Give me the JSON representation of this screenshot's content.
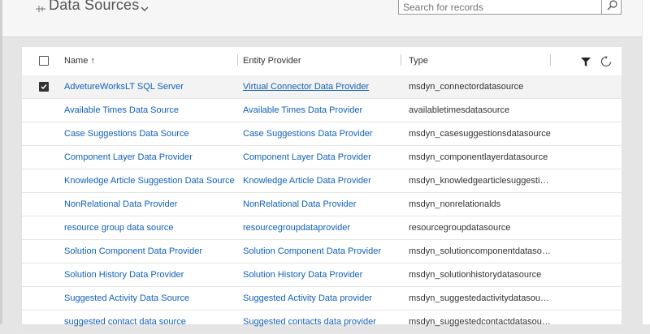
{
  "header": {
    "title": "Data Sources",
    "search_placeholder": "Search for records"
  },
  "grid": {
    "columns": {
      "name": "Name ↑",
      "provider": "Entity Provider",
      "type": "Type"
    },
    "rows": [
      {
        "name": "AdvetureWorksLT SQL Server",
        "provider": "Virtual Connector Data Provider",
        "type": "msdyn_connectordatasource",
        "selected": true
      },
      {
        "name": "Available Times Data Source",
        "provider": "Available Times Data Provider",
        "type": "availabletimesdatasource",
        "selected": false
      },
      {
        "name": "Case Suggestions Data Source",
        "provider": "Case Suggestions Data Provider",
        "type": "msdyn_casesuggestionsdatasource",
        "selected": false
      },
      {
        "name": "Component Layer Data Provider",
        "provider": "Component Layer Data Provider",
        "type": "msdyn_componentlayerdatasource",
        "selected": false
      },
      {
        "name": "Knowledge Article Suggestion Data Source",
        "provider": "Knowledge Article Data Provider",
        "type": "msdyn_knowledgearticlesuggestion...",
        "selected": false
      },
      {
        "name": "NonRelational Data Provider",
        "provider": "NonRelational Data Provider",
        "type": "msdyn_nonrelationalds",
        "selected": false
      },
      {
        "name": "resource group data source",
        "provider": "resourcegroupdataprovider",
        "type": "resourcegroupdatasource",
        "selected": false
      },
      {
        "name": "Solution Component Data Provider",
        "provider": "Solution Component Data Provider",
        "type": "msdyn_solutioncomponentdatasour...",
        "selected": false
      },
      {
        "name": "Solution History Data Provider",
        "provider": "Solution History Data Provider",
        "type": "msdyn_solutionhistorydatasource",
        "selected": false
      },
      {
        "name": "Suggested Activity Data Source",
        "provider": "Suggested Activity Data provider",
        "type": "msdyn_suggestedactivitydatasource",
        "selected": false
      },
      {
        "name": "suggested contact data source",
        "provider": "Suggested contacts data provider",
        "type": "msdyn_suggestedcontactdatasource",
        "selected": false
      }
    ]
  },
  "icons": {
    "pin": "pin-icon",
    "chevron": "chevron-down-icon",
    "search": "search-icon",
    "filter": "filter-icon",
    "refresh": "refresh-icon"
  },
  "colors": {
    "link": "#1160b7",
    "selected_row": "#f3f3f3",
    "background": "#e5e5e5"
  }
}
